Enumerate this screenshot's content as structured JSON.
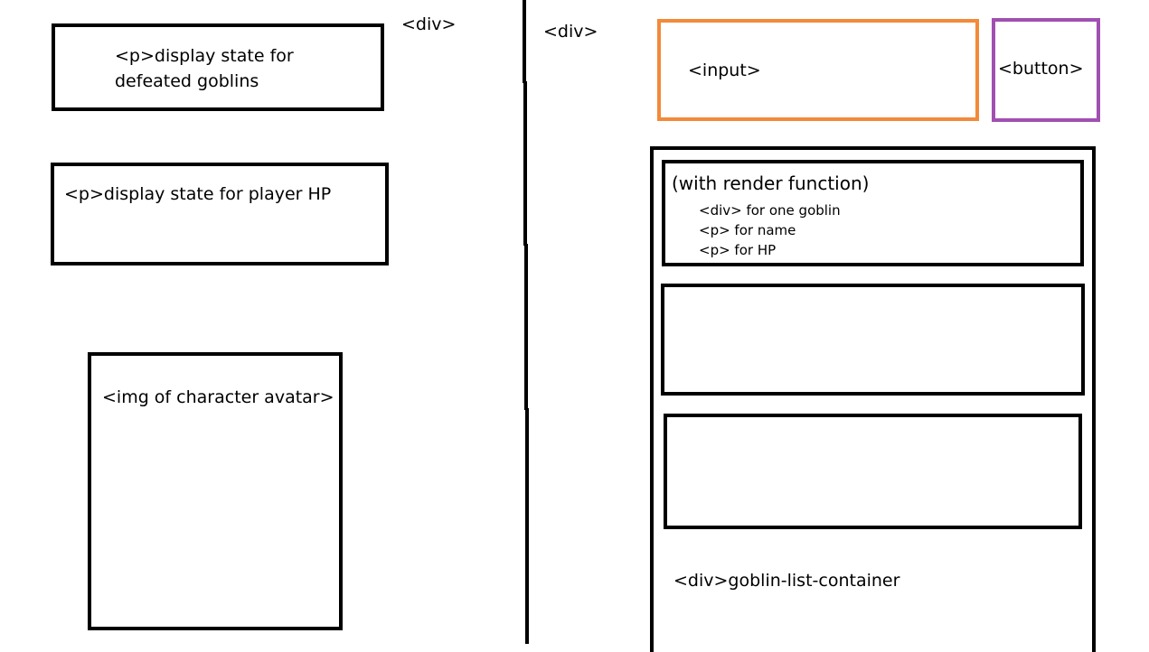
{
  "left_panel": {
    "div_tag": "<div>",
    "defeated_goblins": {
      "line1": "<p>display state for",
      "line2": "defeated goblins"
    },
    "player_hp": {
      "label": "<p>display state for player HP"
    },
    "avatar": {
      "label": "<img of character avatar>"
    }
  },
  "right_panel": {
    "div_tag": "<div>",
    "input": {
      "label": "<input>",
      "color": "#F28A3A"
    },
    "button": {
      "label": "<button>",
      "color": "#A14FB1"
    },
    "goblin_list": {
      "first_item": {
        "title": "(with render function)",
        "line1": "<div> for one goblin",
        "line2": "<p> for name",
        "line3": "<p> for HP"
      },
      "container_label": "<div>goblin-list-container"
    }
  },
  "colors": {
    "stroke": "#000000",
    "background": "#FFFFFF"
  }
}
